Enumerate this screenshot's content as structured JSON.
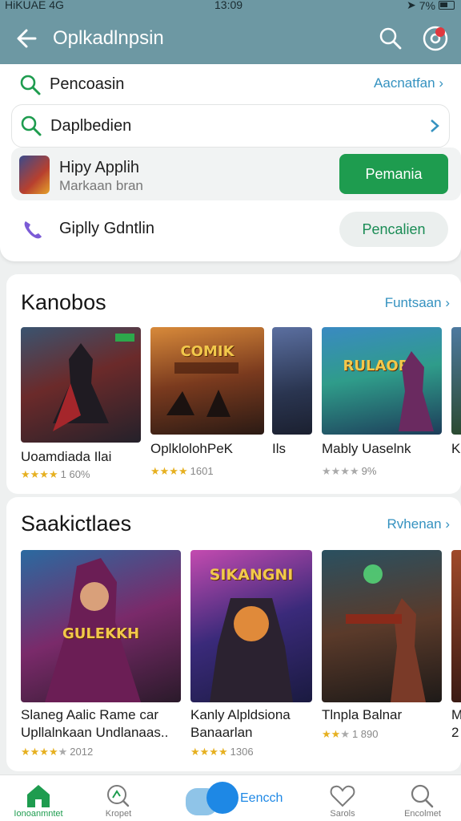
{
  "status_bar": {
    "left": "HiKUAE  4G",
    "time": "13:09",
    "right": "7%"
  },
  "app_bar": {
    "title": "Oplkadlnpsin"
  },
  "search_panel": {
    "row1": {
      "text": "Pencoasin",
      "link": "Aacnatfan"
    },
    "row2": {
      "text": "Daplbedien"
    },
    "row3": {
      "app_name": "Hipy Applih",
      "app_sub": "Markaan bran",
      "button": "Pemania"
    },
    "row4": {
      "text": "Giplly Gdntlin",
      "button": "Pencalien"
    }
  },
  "section1": {
    "title": "Kanobos",
    "link": "Funtsaan",
    "cards": [
      {
        "name": "Uoamdiada Ilai",
        "stars": "★★★★",
        "dim": "",
        "rating": "1 60%"
      },
      {
        "name": "OplklolohPeK",
        "stars": "★★★★",
        "dim": "",
        "rating": "1601"
      },
      {
        "name": "Ils",
        "stars": "",
        "dim": "",
        "rating": ""
      },
      {
        "name": "Mably Uaselnk",
        "stars": "",
        "dim": "★★★★",
        "rating": "9%"
      },
      {
        "name": "K",
        "stars": "",
        "dim": "",
        "rating": ""
      }
    ],
    "art_labels": [
      "",
      "COMIK",
      "",
      "RULAORR",
      ""
    ]
  },
  "section2": {
    "title": "Saakictlaes",
    "link": "Rvhenan",
    "cards": [
      {
        "name": "Slaneg Aalic Rame car",
        "name2": "Upllalnkaan Undlanaas..",
        "stars": "★★★★",
        "dim": "★",
        "rating": "2012"
      },
      {
        "name": "Kanly Alpldsiona",
        "name2": "Banaarlan",
        "stars": "★★★★",
        "dim": "",
        "rating": "1306"
      },
      {
        "name": "Tlnpla Balnar",
        "name2": "",
        "stars": "★★",
        "dim": "★",
        "rating": "1 890"
      },
      {
        "name": "M",
        "name2": "2",
        "stars": "★",
        "dim": "",
        "rating": ""
      }
    ],
    "art_labels": [
      "GULEKKH",
      "SIKANGNI",
      "",
      ""
    ]
  },
  "bottom_nav": {
    "home": "Ionoanmntet",
    "item2": "Kropet",
    "center": "Eencch",
    "item4": "Sarols",
    "item5": "Encolmet"
  },
  "colors": {
    "header": "#6d98a3",
    "accent_green": "#1e9c4f",
    "link_blue": "#3592c0",
    "nav_blue": "#1e88e5"
  }
}
